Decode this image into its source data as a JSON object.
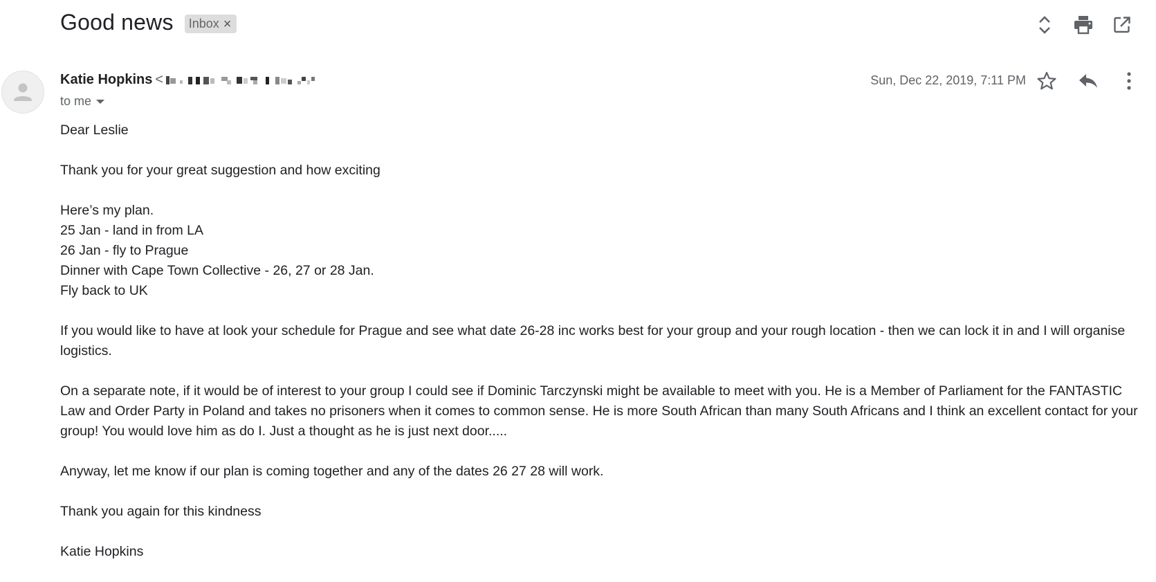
{
  "subject": "Good news",
  "label_chip": {
    "label": "Inbox",
    "remove_glyph": "×"
  },
  "toolbar_icons": [
    "expand-collapse-icon",
    "print-icon",
    "open-in-new-window-icon"
  ],
  "sender": {
    "name": "Katie Hopkins",
    "email_prefix": "<",
    "recipient_line": "to me"
  },
  "message": {
    "date": "Sun, Dec 22, 2019, 7:11 PM",
    "actions": [
      "star-icon",
      "reply-icon",
      "more-options-icon"
    ]
  },
  "body": {
    "greeting": "Dear Leslie",
    "thanks": "Thank you for your great suggestion and how exciting",
    "plan": [
      "Here’s my plan.",
      "25 Jan - land in from LA",
      "26 Jan - fly to Prague",
      "Dinner with Cape Town Collective - 26, 27 or 28 Jan.",
      "Fly back to UK"
    ],
    "para_schedule": "If you would like to have at look your schedule for Prague and see what date 26-28 inc works best for your group and your rough location - then we can lock it in and I will organise logistics.",
    "para_note": "On a separate note, if it would be of interest to your group I could see if Dominic Tarczynski might be available to meet with you. He is a Member of Parliament for the FANTASTIC Law and Order Party in Poland and takes no prisoners when it comes to common sense. He is more South African than many South Africans and I think an excellent contact for your group! You would love him as do I. Just a thought as he is just next door.....",
    "para_anyway": "Anyway, let me know if our plan is coming together and any of the dates 26 27 28 will work.",
    "para_thanks_again": "Thank you again for this kindness",
    "signature": "Katie Hopkins"
  }
}
